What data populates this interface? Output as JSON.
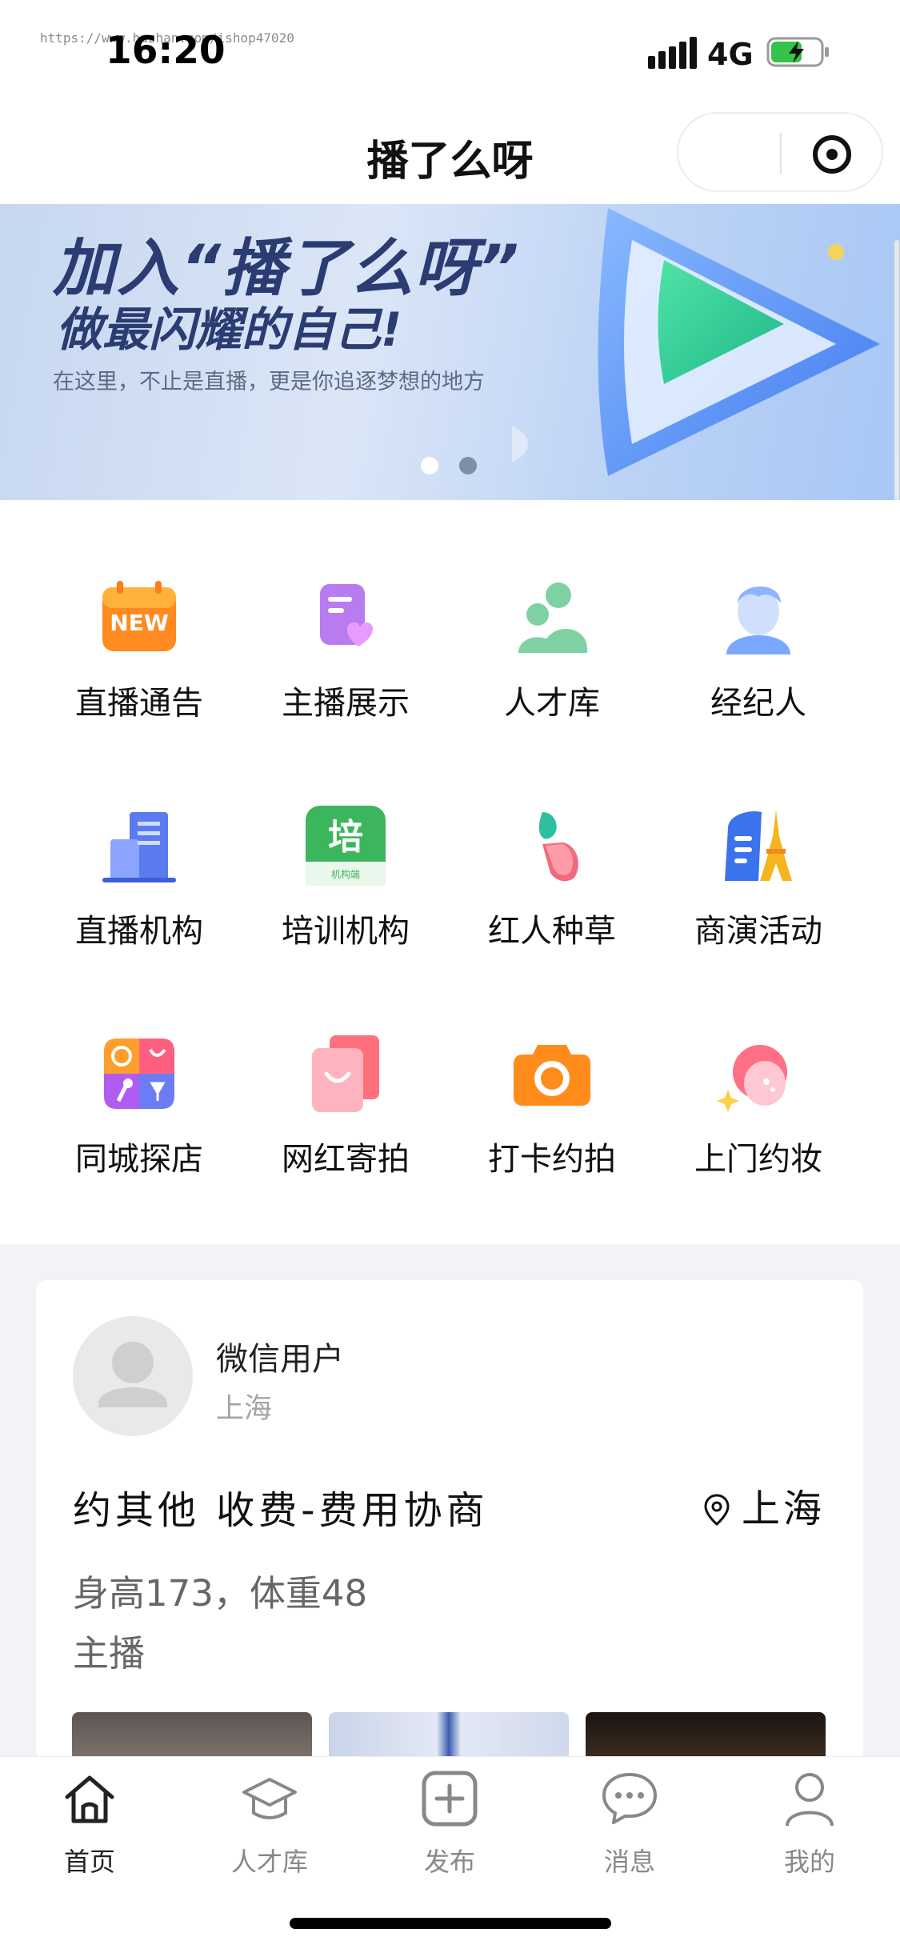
{
  "status_bar": {
    "watermark": "https://www.huzhan.com/ishop47020",
    "time": "16:20",
    "network": "4G"
  },
  "nav": {
    "title": "播了么呀"
  },
  "banner": {
    "headline": "加入“播了么呀”",
    "subheadline": "做最闪耀的自己!",
    "tagline": "在这里，不止是直播，更是你追逐梦想的地方",
    "slide_count": 2,
    "active_slide": 1
  },
  "categories": [
    {
      "label": "直播通告",
      "icon": "new-badge-icon"
    },
    {
      "label": "主播展示",
      "icon": "profile-heart-icon"
    },
    {
      "label": "人才库",
      "icon": "people-icon"
    },
    {
      "label": "经纪人",
      "icon": "agent-avatar-icon"
    },
    {
      "label": "直播机构",
      "icon": "building-icon"
    },
    {
      "label": "培训机构",
      "icon": "training-icon",
      "icon_text": "培",
      "icon_subtext": "机构端"
    },
    {
      "label": "红人种草",
      "icon": "sprout-icon"
    },
    {
      "label": "商演活动",
      "icon": "eiffel-tower-icon"
    },
    {
      "label": "同城探店",
      "icon": "entertainment-icon"
    },
    {
      "label": "网红寄拍",
      "icon": "shopping-bag-icon"
    },
    {
      "label": "打卡约拍",
      "icon": "camera-icon"
    },
    {
      "label": "上门约妆",
      "icon": "makeup-icon"
    }
  ],
  "post": {
    "username": "微信用户",
    "user_city": "上海",
    "title": "约其他  收费-费用协商",
    "location": "上海",
    "description": "身高173，体重48",
    "role": "主播"
  },
  "tabbar": [
    {
      "label": "首页",
      "icon": "home-icon",
      "active": true
    },
    {
      "label": "人才库",
      "icon": "graduation-cap-icon",
      "active": false
    },
    {
      "label": "发布",
      "icon": "plus-square-icon",
      "active": false
    },
    {
      "label": "消息",
      "icon": "chat-bubble-icon",
      "active": false
    },
    {
      "label": "我的",
      "icon": "user-icon",
      "active": false
    }
  ],
  "colors": {
    "banner_text": "#2a3c72",
    "feed_background": "#f1f3f8",
    "tab_inactive": "#888888",
    "tab_active": "#222222"
  }
}
